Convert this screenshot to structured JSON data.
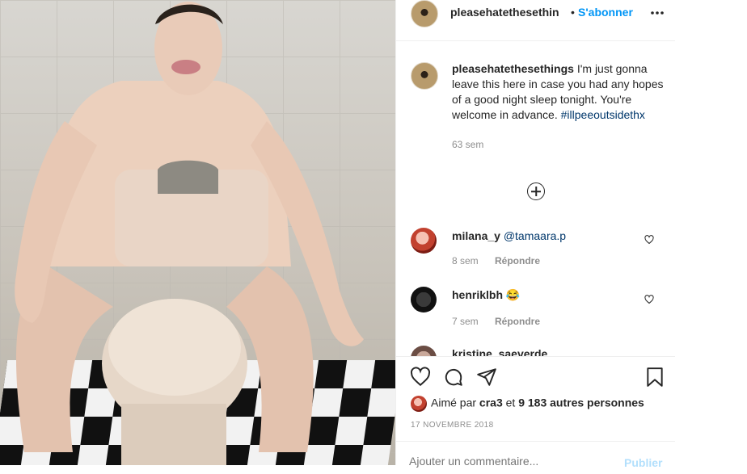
{
  "post": {
    "username_short": "pleasehatethesethin",
    "dot": "•",
    "follow_label": "S'abonner",
    "more_icon": "more-icon",
    "caption_username": "pleasehatethesethings",
    "caption_text": " I'm just gonna leave this here in case you had any hopes of a good night sleep tonight. You're welcome in advance. ",
    "caption_hashtag": "#illpeeoutsidethx",
    "caption_time": "63 sem"
  },
  "comments": [
    {
      "username": "milana_y",
      "text": "@tamaara.p",
      "time": "8 sem",
      "reply": "Répondre"
    },
    {
      "username": "henriklbh",
      "text": "😂",
      "time": "7 sem",
      "reply": "Répondre"
    },
    {
      "username": "kristine_saeverde",
      "text": "",
      "time": "",
      "reply": ""
    }
  ],
  "actions": {
    "liked_prefix": "Aimé par ",
    "liked_user": "cra3",
    "liked_mid": " et ",
    "liked_count": "9 183 autres personnes",
    "date": "17 NOVEMBRE 2018",
    "comment_placeholder": "Ajouter un commentaire...",
    "publish_label": "Publier"
  }
}
